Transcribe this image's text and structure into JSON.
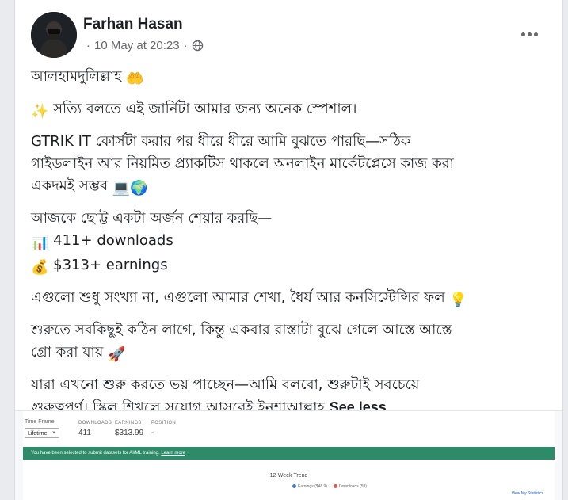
{
  "post": {
    "author": "Farhan Hasan",
    "timestamp": "10 May at 20:23",
    "separator": "·",
    "paragraphs": [
      {
        "lines": [
          {
            "text": "আলহামদুলিল্লাহ",
            "emoji": "🤲"
          }
        ]
      },
      {
        "lines": [
          {
            "emoji_before": "✨",
            "text": "সত্যি বলতে এই জার্নিটা আমার জন্য অনেক স্পেশাল।"
          }
        ]
      },
      {
        "lines": [
          {
            "text": "GTRIK IT কোর্সটা করার পর ধীরে ধীরে আমি বুঝতে পারছি—সঠিক"
          },
          {
            "text": "গাইডলাইন আর নিয়মিত প্র্যাকটিস থাকলে অনলাইন মার্কেটপ্লেসে কাজ করা"
          },
          {
            "text": "একদমই সম্ভব",
            "emoji": "💻🌍"
          }
        ]
      },
      {
        "lines": [
          {
            "text": "আজকে ছোট্ট একটা অর্জন শেয়ার করছি—"
          },
          {
            "emoji_before": "📊",
            "text": "411+ downloads"
          },
          {
            "emoji_before": "💰",
            "text": "$313+ earnings"
          }
        ]
      },
      {
        "lines": [
          {
            "text": "এগুলো শুধু সংখ্যা না, এগুলো আমার শেখা, ধৈর্য আর কনসিস্টেন্সির ফল",
            "emoji": "💡"
          }
        ]
      },
      {
        "lines": [
          {
            "text": "শুরুতে সবকিছুই কঠিন লাগে, কিন্তু একবার রাস্তাটা বুঝে গেলে আস্তে আস্তে"
          },
          {
            "text": "গ্রো করা যায়",
            "emoji": "🚀"
          }
        ]
      },
      {
        "lines": [
          {
            "text": "যারা এখনো শুরু করতে ভয় পাচ্ছেন—আমি বলবো, শুরুটাই সবচেয়ে"
          },
          {
            "text": "গুরুত্বপূর্ণ। স্কিল শিখলে সুযোগ আসবেই ইনশাআল্লাহ"
          }
        ]
      }
    ],
    "see_less": "See less",
    "icons": {
      "privacy": "globe-icon",
      "menu": "more-options-icon"
    }
  },
  "attachment": {
    "time_frame_label": "Time Frame",
    "time_frame_value": "Lifetime",
    "stats": [
      {
        "label": "DOWNLOADS",
        "value": "411"
      },
      {
        "label": "EARNINGS",
        "value": "$313.99"
      },
      {
        "label": "POSITION",
        "value": "-"
      }
    ],
    "banner_text": "You have been selected to submit datasets for AI/ML training.",
    "banner_link": "Learn more",
    "trend_title": "12-Week Trend",
    "legend": [
      {
        "name": "Earnings ($48.9)",
        "color": "#4a7bd6"
      },
      {
        "name": "Downloads (59)",
        "color": "#e0554e"
      }
    ],
    "view_stats": "View My Statistics",
    "colors": {
      "banner": "#2e8b6a"
    }
  }
}
